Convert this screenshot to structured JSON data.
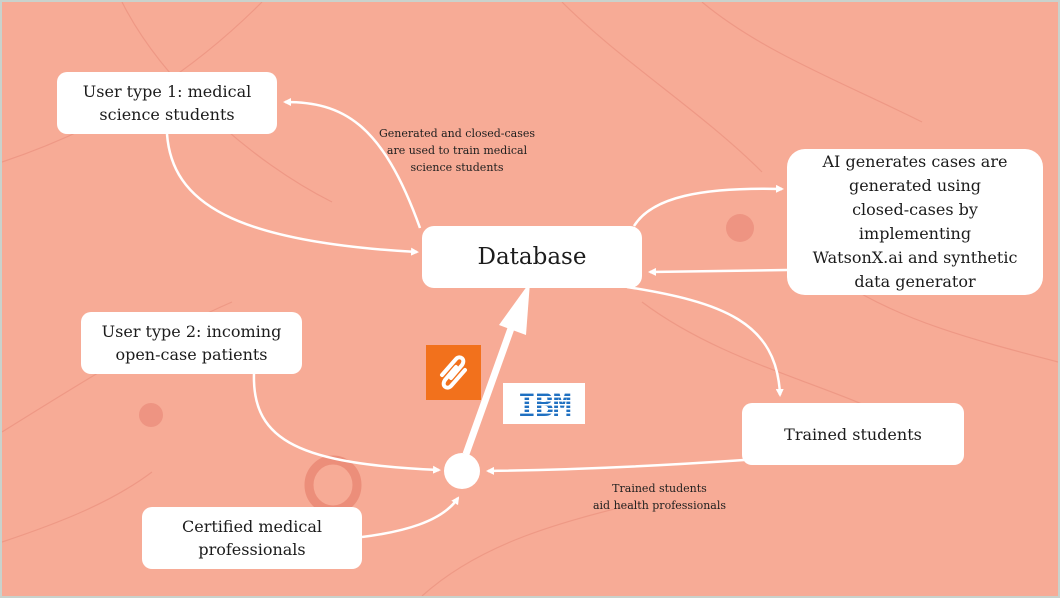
{
  "nodes": {
    "user1": "User type 1: medical\nscience students",
    "database": "Database",
    "ai": "AI generates cases are\ngenerated using\nclosed-cases by\nimplementing\nWatsonX.ai and synthetic\ndata generator",
    "user2": "User type 2: incoming\nopen-case patients",
    "trained": "Trained students",
    "certified": "Certified medical\nprofessionals"
  },
  "annotations": {
    "top": "Generated and closed-cases\nare used to train medical\nscience students",
    "bottom": "Trained students\naid health professionals"
  },
  "logos": {
    "watsonx": "watsonx-icon",
    "ibm": "IBM"
  },
  "colors": {
    "background": "#f7ab96",
    "node_fill": "#ffffff",
    "connector": "#ffffff",
    "watsonx_orange": "#f2711c",
    "ibm_blue": "#1f70c1"
  }
}
